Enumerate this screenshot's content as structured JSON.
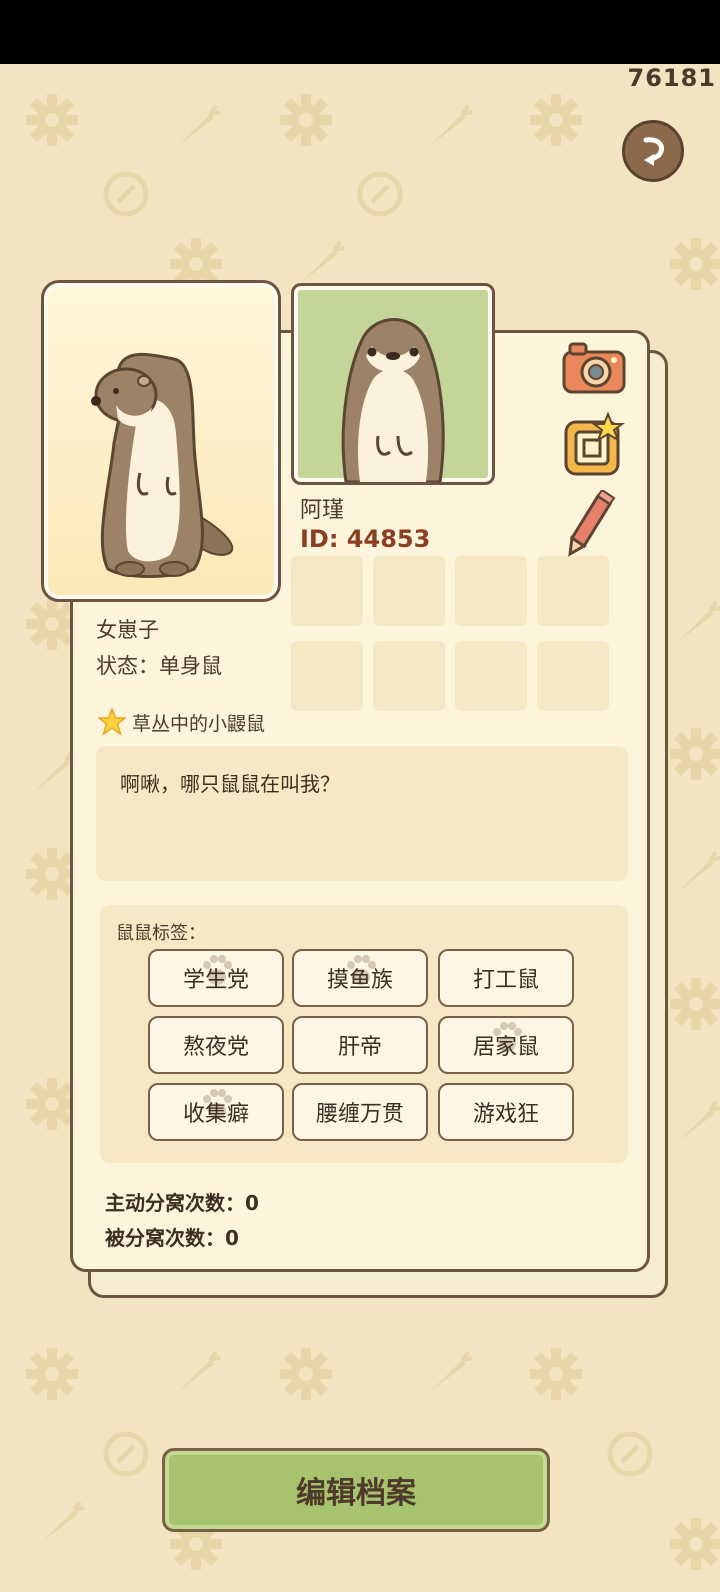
{
  "header": {
    "coins": "76181"
  },
  "profile": {
    "name": "阿瑾",
    "id": "ID: 44853",
    "gender": "女崽子",
    "status": "状态：单身鼠",
    "title": "草丛中的小鼹鼠",
    "bio": "啊啾，哪只鼠鼠在叫我？"
  },
  "tags": {
    "label": "鼠鼠标签：",
    "items": [
      "学生党",
      "摸鱼族",
      "打工鼠",
      "熬夜党",
      "肝帝",
      "居家鼠",
      "收集癖",
      "腰缠万贯",
      "游戏狂"
    ]
  },
  "stats": {
    "active_split": "主动分窝次数：0",
    "passive_split": "被分窝次数：0"
  },
  "actions": {
    "edit_label": "编辑档案"
  },
  "colors": {
    "background": "#f3e4c1",
    "card": "#fdf4dc",
    "border": "#6d5440",
    "button": "#a8c36e",
    "id_color": "#8a3e22"
  },
  "icons": [
    "back-arrow-icon",
    "camera-icon",
    "frame-star-icon",
    "pencil-icon",
    "star-icon",
    "paw-icon"
  ]
}
